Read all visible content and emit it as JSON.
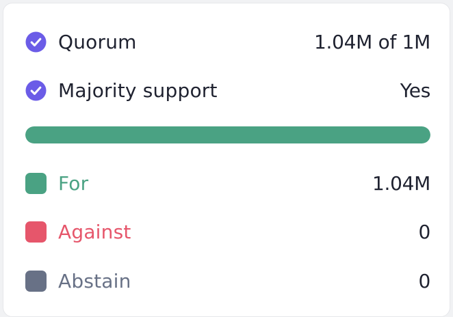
{
  "colors": {
    "check": "#6b5ce7",
    "for": "#4aa283",
    "against": "#e6566b",
    "abstain": "#687186",
    "text": "#1f2230"
  },
  "criteria": [
    {
      "label": "Quorum",
      "value": "1.04M of 1M",
      "icon": "check-circle-icon"
    },
    {
      "label": "Majority support",
      "value": "Yes",
      "icon": "check-circle-icon"
    }
  ],
  "progress": {
    "for_fraction": 1.0,
    "against_fraction": 0.0,
    "abstain_fraction": 0.0
  },
  "votes": [
    {
      "label": "For",
      "value": "1.04M"
    },
    {
      "label": "Against",
      "value": "0"
    },
    {
      "label": "Abstain",
      "value": "0"
    }
  ]
}
